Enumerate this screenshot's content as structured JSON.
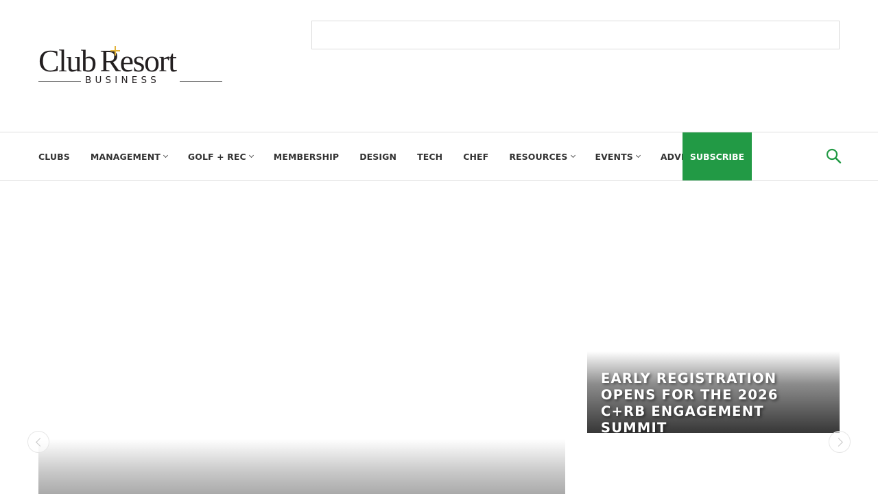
{
  "logo": {
    "word_left": "Club",
    "word_right": "Resort",
    "subtitle": "BUSINESS",
    "plus_color": "#e2b33b"
  },
  "nav": {
    "items": [
      {
        "label": "CLUBS",
        "has_dropdown": false
      },
      {
        "label": "MANAGEMENT",
        "has_dropdown": true
      },
      {
        "label": "GOLF + REC",
        "has_dropdown": true
      },
      {
        "label": "MEMBERSHIP",
        "has_dropdown": false
      },
      {
        "label": "DESIGN",
        "has_dropdown": false
      },
      {
        "label": "TECH",
        "has_dropdown": false
      },
      {
        "label": "CHEF",
        "has_dropdown": false
      },
      {
        "label": "RESOURCES",
        "has_dropdown": true
      },
      {
        "label": "EVENTS",
        "has_dropdown": true
      },
      {
        "label": "ADVERTISE",
        "has_dropdown": false
      }
    ],
    "subscribe_label": "SUBSCRIBE",
    "subscribe_color": "#229a45",
    "search_icon": "search-icon",
    "accent_color": "#229a45"
  },
  "hero": {
    "feature_title": "EARLY REGISTRATION OPENS FOR THE 2026 C+RB ENGAGEMENT SUMMIT",
    "prev_icon": "chevron-left-icon",
    "next_icon": "chevron-right-icon"
  }
}
